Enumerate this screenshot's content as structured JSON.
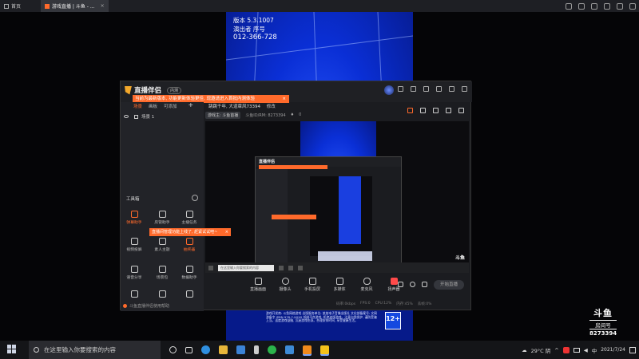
{
  "topbar": {
    "tabs": [
      {
        "label": "首页"
      },
      {
        "label": "游戏直播 | 斗鱼 - ...",
        "close": "×"
      }
    ]
  },
  "game": {
    "line1": "版本 5.3.1007",
    "line2": "演出者 序号",
    "line3": "012-366-728"
  },
  "app": {
    "name": "直播伴侣",
    "badge": "内测",
    "version_toast": "当前为最新版本, 功能更新体验更佳, 现邀请进入首批内测体验",
    "version_toast_close": "×",
    "left_tabs": [
      "场景",
      "画板",
      "可添加"
    ],
    "left_tabs_add": "+",
    "scene_label": "场景 1",
    "tools_label": "工具箱",
    "tools": [
      {
        "label": "弹幕助手"
      },
      {
        "label": "房管助手"
      },
      {
        "label": "主播任务"
      },
      {
        "label": "视频投屏"
      },
      {
        "label": "素人主题"
      },
      {
        "label": "抽奖器"
      },
      {
        "label": "语音分享"
      },
      {
        "label": "场景包"
      },
      {
        "label": "数据助手"
      },
      {
        "label": "礼物展示"
      },
      {
        "label": "更多"
      },
      {
        "label": "开播设置"
      }
    ],
    "left_toast": "直播间管理功能上线了, 赶紧试试吧~",
    "left_toast_close": "×",
    "left_footer": "斗鱼直播伴侣使用帮助",
    "notice": "跳跳千年, 大道章风73394",
    "notice_btn": "修改",
    "info_chip": "游戏主: 斗鱼首播",
    "info_room": "斗鱼ID/RM: 8273394",
    "info_hot": "0",
    "preview_logo": "斗鱼",
    "preview_search": "在这里输入你要搜索的内容",
    "controls": [
      {
        "label": "直播画面"
      },
      {
        "label": "摄像头"
      },
      {
        "label": "手机投屏"
      },
      {
        "label": "多媒体"
      },
      {
        "label": "麦克风"
      },
      {
        "label": "扬声器"
      }
    ],
    "start_button": "开始直播",
    "stats": [
      "码率:0kbps",
      "FPS:0",
      "CPU:12%",
      "内存:45%",
      "丢帧:0%"
    ]
  },
  "credits": {
    "text": "游戏开发商: 斗鱼网络游戏 出版服务单位: 某某电子音像出版社 文化部备案号: 文网游备字 ISBN 978-7-XXXX 抵制不良游戏, 拒绝盗版游戏。注意自我保护, 谨防受骗上当。适度游戏益脑, 沉迷游戏伤身。合理安排时间, 享受健康生活。",
    "age": "12+"
  },
  "watermark": {
    "logo": "斗鱼",
    "room_label": "房间号",
    "room": "8273394"
  },
  "taskbar": {
    "search_placeholder": "在这里输入你要搜索的内容",
    "weather": "29°C 阴",
    "input": "中",
    "time": "",
    "date": "2021/7/24"
  },
  "colors": {
    "accent": "#ff6a2b",
    "bg": "#1b1c20",
    "game_blue": "#0a2fd6"
  }
}
